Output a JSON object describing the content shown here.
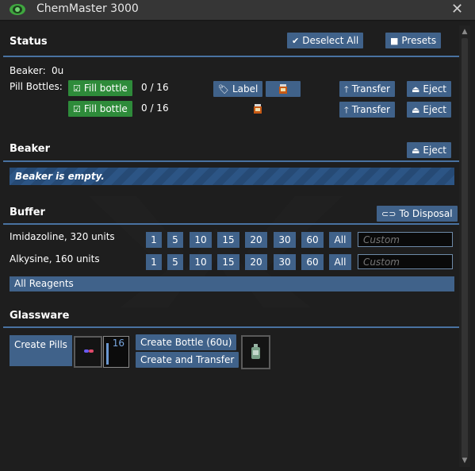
{
  "window": {
    "title": "ChemMaster 3000",
    "close_glyph": "✕"
  },
  "status": {
    "heading": "Status",
    "deselect_all": "Deselect All",
    "presets": "Presets",
    "beaker_label": "Beaker:",
    "beaker_value": "0u",
    "pill_bottles_label": "Pill Bottles:",
    "bottles": [
      {
        "fill_label": "Fill bottle",
        "count": "0 / 16",
        "has_label_button": true,
        "label_button": "Label",
        "transfer": "Transfer",
        "eject": "Eject"
      },
      {
        "fill_label": "Fill bottle",
        "count": "0 / 16",
        "has_label_button": false,
        "transfer": "Transfer",
        "eject": "Eject"
      }
    ]
  },
  "beaker": {
    "heading": "Beaker",
    "eject": "Eject",
    "empty_text": "Beaker is empty."
  },
  "buffer": {
    "heading": "Buffer",
    "to_disposal": "To Disposal",
    "reagents": [
      {
        "name": "Imidazoline, 320 units"
      },
      {
        "name": "Alkysine, 160 units"
      }
    ],
    "amounts": [
      "1",
      "5",
      "10",
      "15",
      "20",
      "30",
      "60",
      "All"
    ],
    "custom_placeholder": "Custom",
    "all_reagents": "All Reagents"
  },
  "glassware": {
    "heading": "Glassware",
    "create_pills": "Create Pills",
    "count": "16",
    "create_bottle": "Create Bottle (60u)",
    "create_and_transfer": "Create and Transfer"
  },
  "icons": {
    "app": "eye-icon",
    "deselect": "double-check-icon",
    "presets": "floppy-disk-icon",
    "fill": "checkbox-icon",
    "label": "tag-icon",
    "transfer": "arrow-up-icon",
    "eject": "eject-icon",
    "disposal": "toggle-icon"
  },
  "colors": {
    "accent": "#40628a",
    "divider": "#4972a1",
    "green": "#2e8b3a",
    "background": "#1e1e1e",
    "titlebar": "#363636"
  }
}
